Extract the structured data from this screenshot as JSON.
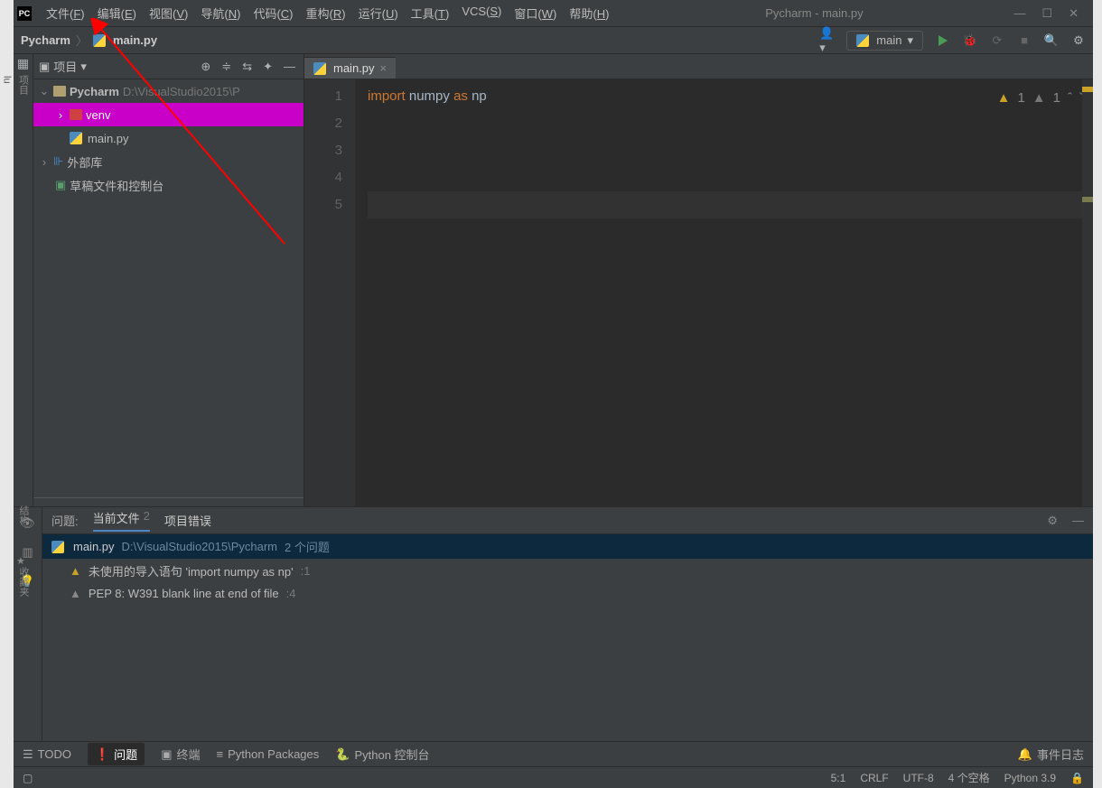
{
  "menu": {
    "file": "文件(",
    "edit": "编辑(",
    "view": "视图(",
    "nav": "导航(",
    "code": "代码(",
    "refactor": "重构(",
    "run": "运行(",
    "tools": "工具(",
    "vcs": "VCS(",
    "window": "窗口(",
    "help": "帮助(",
    "file_k": "F",
    "edit_k": "E",
    "view_k": "V",
    "nav_k": "N",
    "code_k": "C",
    "refactor_k": "R",
    "run_k": "U",
    "tools_k": "T",
    "vcs_k": "S",
    "window_k": "W",
    "help_k": "H"
  },
  "title": "Pycharm - main.py",
  "breadcrumb": {
    "project": "Pycharm",
    "file": "main.py"
  },
  "runconfig": "main",
  "project_label": "项目",
  "sidebar_vert": "项目",
  "tree": {
    "root": "Pycharm",
    "root_path": "D:\\VisualStudio2015\\P",
    "venv": "venv",
    "mainpy": "main.py",
    "ext": "外部库",
    "scratch": "草稿文件和控制台"
  },
  "tab_file": "main.py",
  "code": {
    "l1": "import numpy as np"
  },
  "inspect": {
    "w1": "1",
    "w2": "1"
  },
  "problems": {
    "title": "问题:",
    "tab_current": "当前文件",
    "count": "2",
    "tab_project": "项目错误",
    "file": "main.py",
    "file_path": "D:\\VisualStudio2015\\Pycharm",
    "file_count": "2 个问题",
    "i1": "未使用的导入语句 'import numpy as np'",
    "i1n": ":1",
    "i2": "PEP 8: W391 blank line at end of file",
    "i2n": ":4"
  },
  "bottom": {
    "todo": "TODO",
    "problems": "问题",
    "terminal": "终端",
    "pypkg": "Python Packages",
    "pyconsole": "Python 控制台",
    "eventlog": "事件日志"
  },
  "leftbar": {
    "structure": "结构",
    "favorites": "收藏夹"
  },
  "status": {
    "pos": "5:1",
    "eol": "CRLF",
    "enc": "UTF-8",
    "indent": "4 个空格",
    "py": "Python 3.9"
  }
}
